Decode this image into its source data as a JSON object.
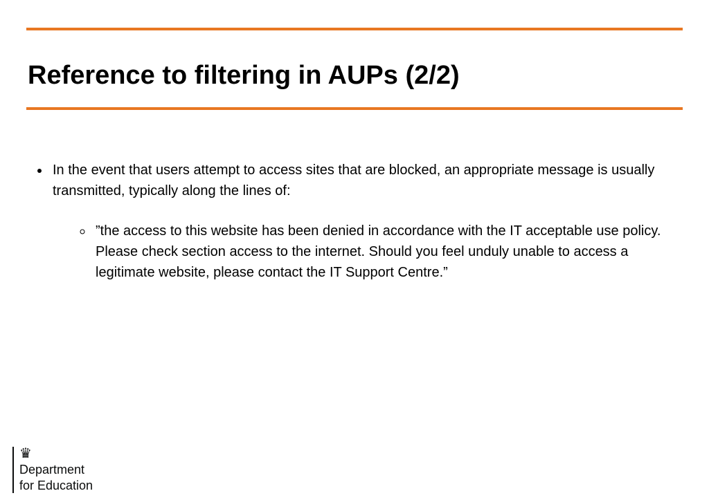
{
  "colors": {
    "accent": "#e87722",
    "text": "#000000"
  },
  "title": "Reference to filtering in AUPs (2/2)",
  "bullets": {
    "item1": "In the event that users attempt to access sites that are blocked, an appropriate message is usually transmitted, typically along the lines of:",
    "sub1": "”the access to this website has been denied in accordance with the IT acceptable use policy. Please check section access to the internet. Should you feel unduly unable to access a legitimate website, please contact the IT Support Centre.”"
  },
  "footer": {
    "line1": "Department",
    "line2": "for Education",
    "crest_glyph": "♛"
  }
}
